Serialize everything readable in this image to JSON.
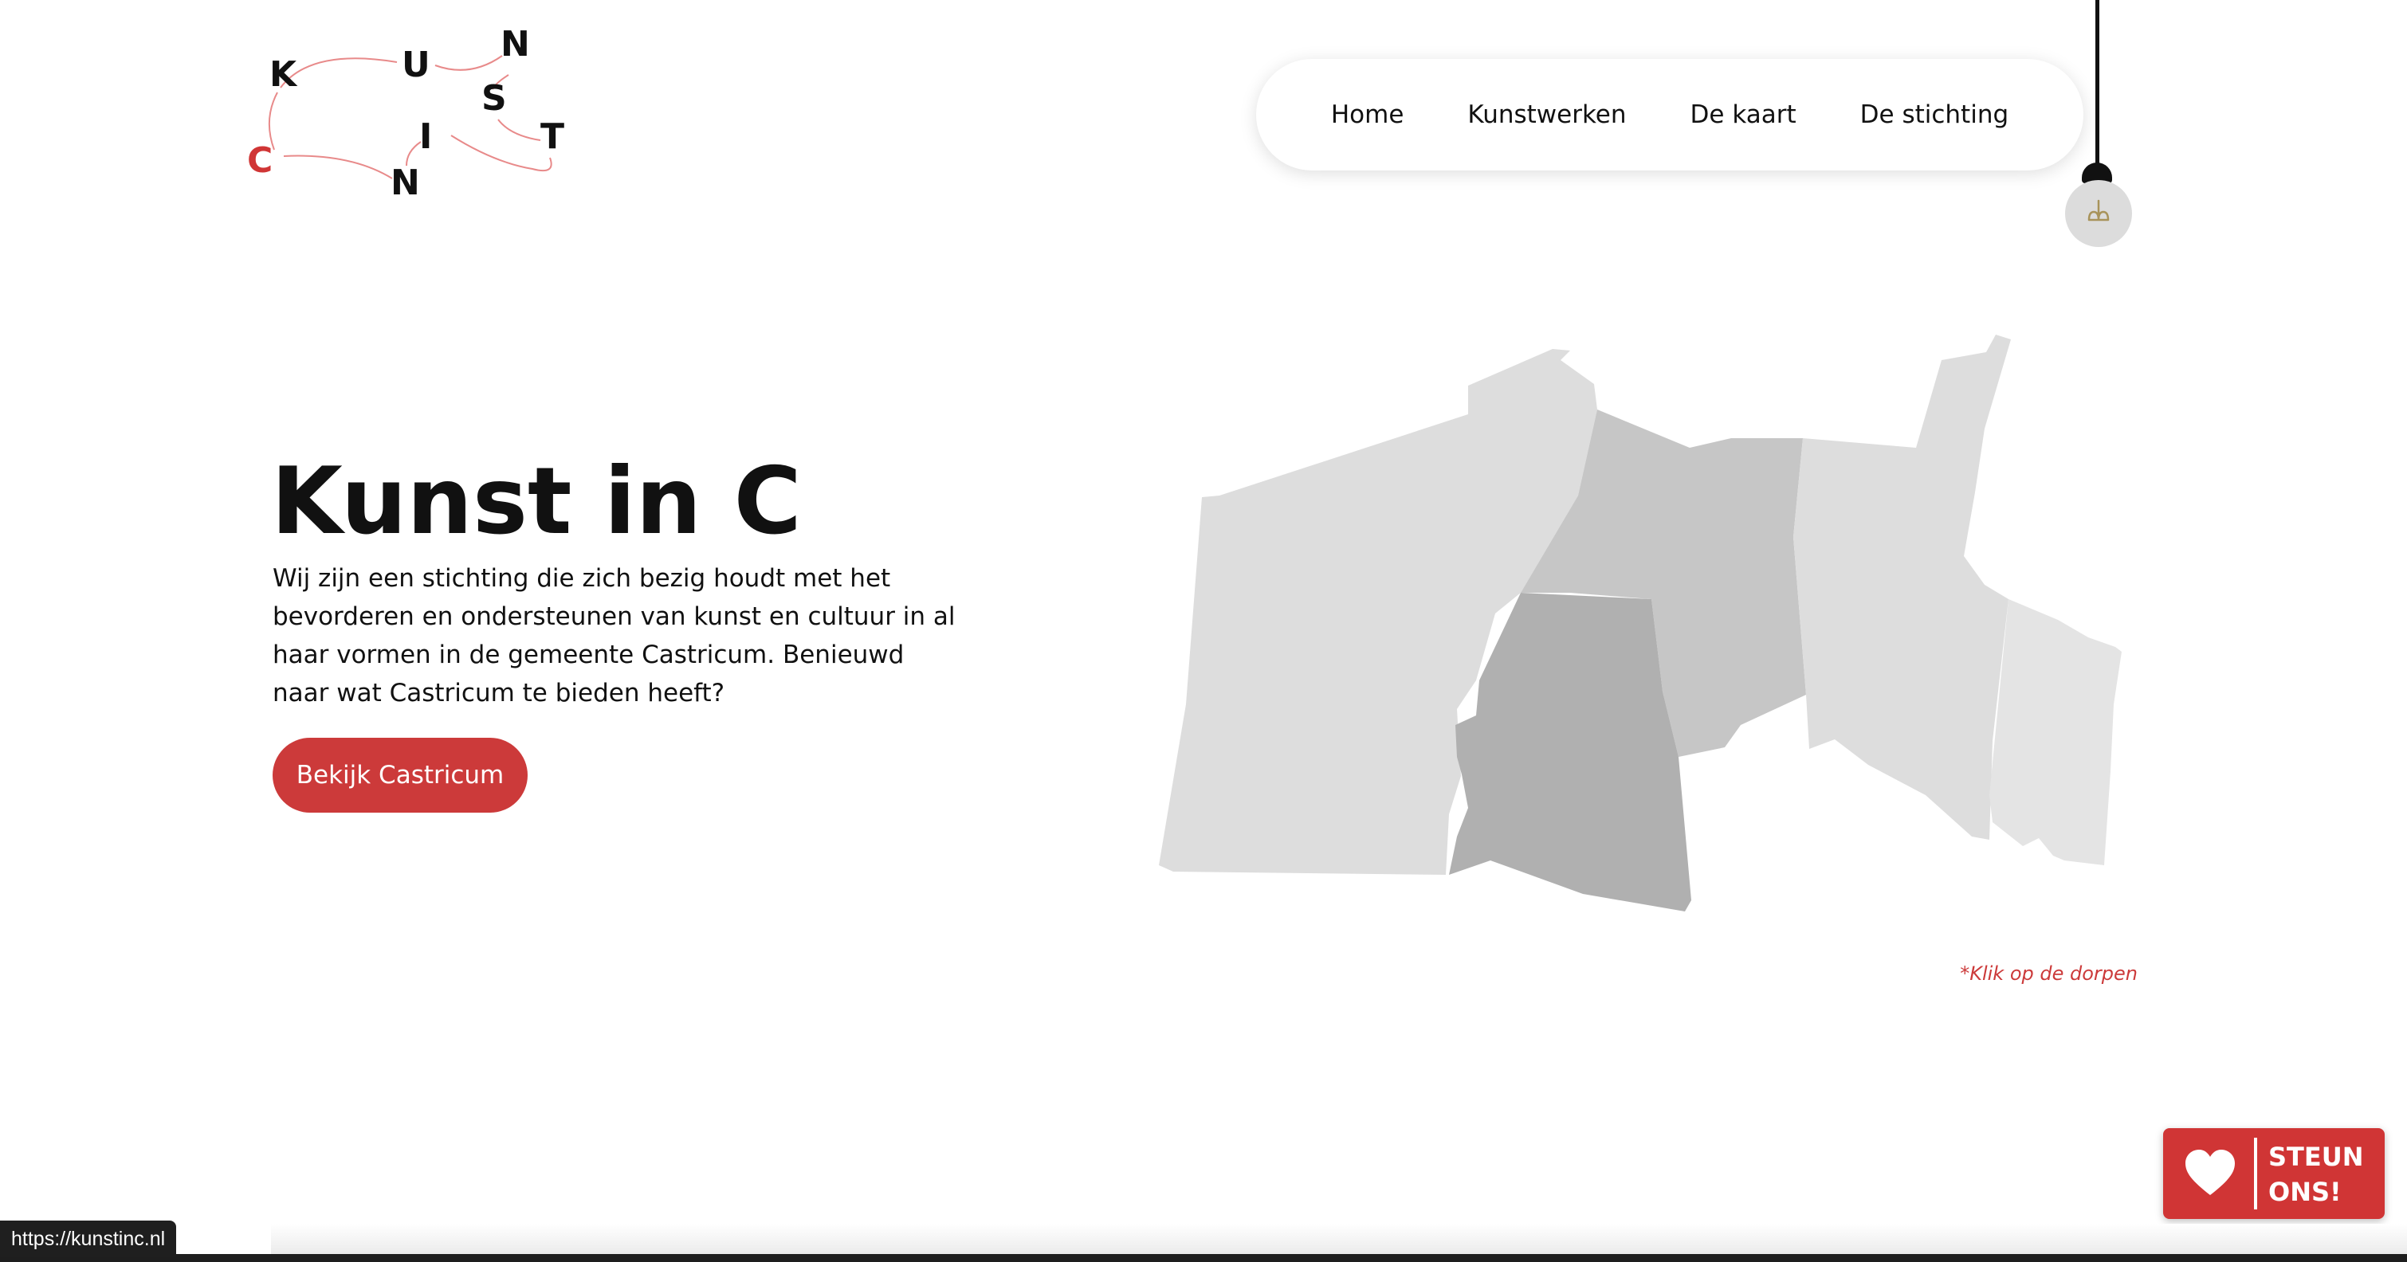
{
  "logo": {
    "letters": [
      "K",
      "U",
      "N",
      "S",
      "T",
      "I",
      "N",
      "C"
    ],
    "colors": {
      "dark": "#111111",
      "accent": "#d03535",
      "arrow": "#e88a8a"
    }
  },
  "nav": {
    "items": [
      {
        "label": "Home"
      },
      {
        "label": "Kunstwerken"
      },
      {
        "label": "De kaart"
      },
      {
        "label": "De stichting"
      }
    ]
  },
  "lamp": {
    "icon": "lightbulb-icon"
  },
  "hero": {
    "title": "Kunst in C",
    "description": "Wij zijn een stichting die zich bezig houdt met het bevorderen en ondersteunen van kunst en cultuur in al haar vormen in de gemeente Castricum. Benieuwd naar wat Castricum te bieden heeft?",
    "cta_label": "Bekijk Castricum"
  },
  "map": {
    "hint": "*Klik op de dorpen",
    "colors": {
      "light": "#dddddd",
      "mid": "#c6c6c6",
      "dark": "#b0b0b0"
    }
  },
  "support": {
    "label_line1": "STEUN",
    "label_line2": "ONS!",
    "icon": "heart-icon",
    "color": "#d03535"
  },
  "status_bar": {
    "url": "https://kunstinc.nl"
  },
  "theme": {
    "accent": "#cc3a3a",
    "text": "#111111",
    "background": "#ffffff"
  }
}
